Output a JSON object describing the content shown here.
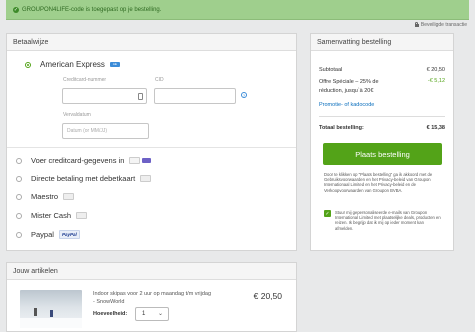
{
  "banner": {
    "text": "GROUPON4LIFE-code is toegepast op je bestelling."
  },
  "secure": {
    "text": "Beveiligde transactie"
  },
  "payment": {
    "heading": "Betaalwijze",
    "selected_method": "American Express",
    "card_number_label": "Creditcard-nummer",
    "cid_label": "CID",
    "expiry_label": "Vervaldatum",
    "expiry_placeholder": "Datum (or MM/JJ)",
    "methods": [
      {
        "label": "Voer creditcard-gegevens in"
      },
      {
        "label": "Directe betaling met debetkaart"
      },
      {
        "label": "Maestro"
      },
      {
        "label": "Mister Cash"
      },
      {
        "label": "Paypal"
      }
    ],
    "paypal_logo": "PayPal"
  },
  "summary": {
    "heading": "Samenvatting bestelling",
    "subtotal_label": "Subtotaal",
    "subtotal_value": "€ 20,50",
    "offer_label": "Offre Spéciale – 25% de réduction, jusqu`à 20€",
    "offer_value": "-€ 5,12",
    "promo_link": "Promotie- of kadocode",
    "total_label": "Totaal bestelling:",
    "total_value": "€ 15,38",
    "place_order": "Plaats bestelling",
    "terms_text": "Door te klikken op \"Plaats bestelling\" ga ik akkoord met de Gebruiksvoorwaarden en het Privacy-beleid van Groupon Internationaal Limited en het Privacy-beleid en de Verkoopvoorwaarden van Groupon BVBA.",
    "newsletter_text": "Stuur mij gepersonaliseerde e-mails van Groupon International Limited met plaatselijke deals, producten en reizen. Ik begrijp dat ik mij op ieder moment kan afmelden.",
    "newsletter_checked": true
  },
  "items": {
    "heading": "Jouw artikelen",
    "list": [
      {
        "title": "Indoor skipas voor 2 uur op maandag t/m vrijdag - SnowWorld",
        "price": "€ 20,50",
        "quantity_label": "Hoeveelheid:",
        "quantity": "1"
      }
    ]
  },
  "colors": {
    "accent": "#53a318",
    "banner_bg": "#9fcf8d",
    "link": "#0a6ebd"
  }
}
